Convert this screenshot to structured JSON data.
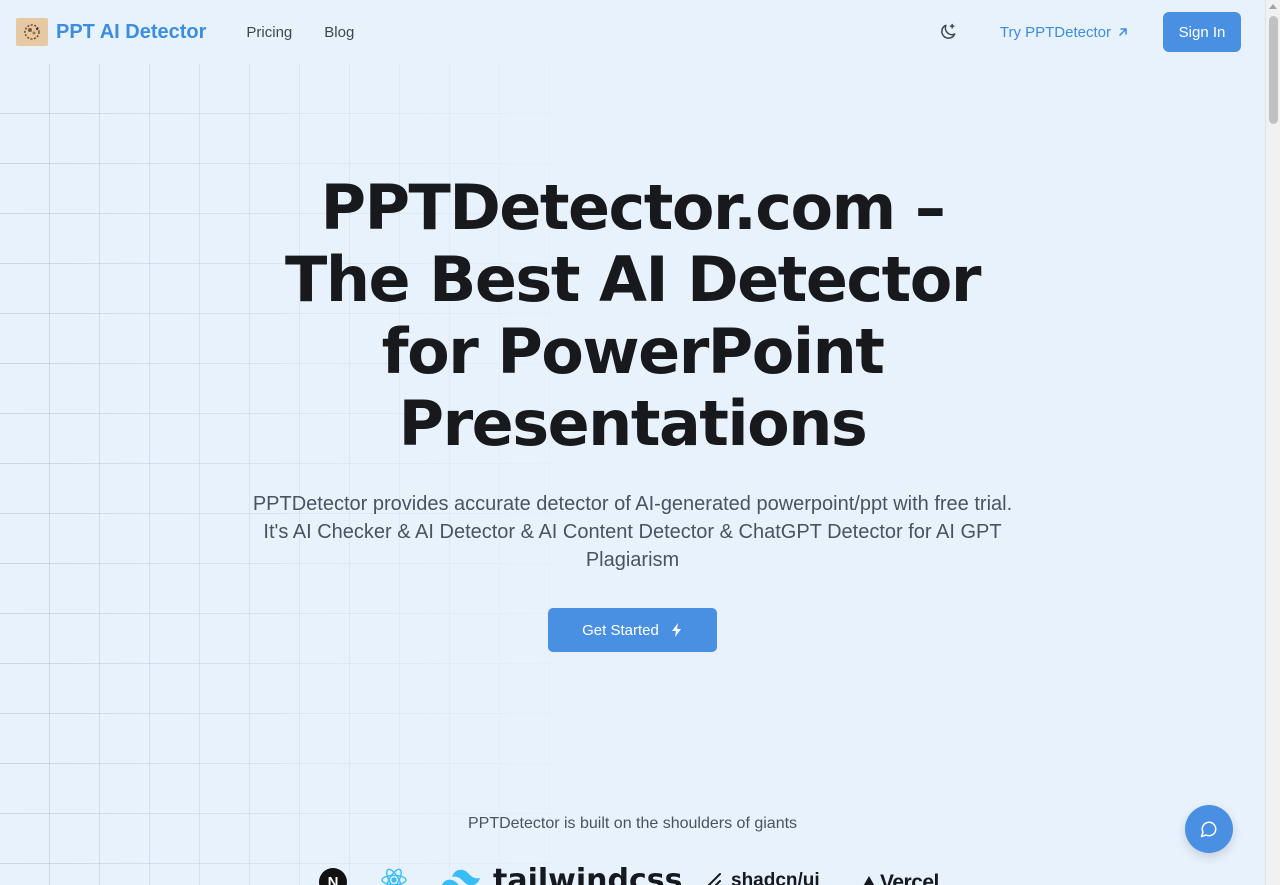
{
  "header": {
    "brand": "PPT AI Detector",
    "nav": [
      "Pricing",
      "Blog"
    ],
    "try_link": "Try PPTDetector",
    "sign_in": "Sign In"
  },
  "hero": {
    "title": "PPTDetector.com – The Best AI Detector for PowerPoint Presentations",
    "subtitle": "PPTDetector provides accurate detector of AI-generated powerpoint/ppt with free trial. It's AI Checker & AI Detector & AI Content Detector & ChatGPT Detector for AI GPT Plagiarism",
    "cta": "Get Started"
  },
  "built_on": {
    "text": "PPTDetector is built on the shoulders of giants",
    "logos": [
      "N",
      "tailwindcss",
      "shadcn/ui",
      "Vercel"
    ]
  },
  "icons": {
    "logo": "brand-logo-icon",
    "theme": "moon-sparkle-icon",
    "external": "arrow-up-right-icon",
    "cta": "lightning-bolt-icon",
    "chat": "chat-bubble-icon"
  },
  "colors": {
    "accent": "#4a90e2",
    "brand_text": "#3b8de0",
    "background": "#e8f2fd",
    "heading": "#17191d"
  }
}
